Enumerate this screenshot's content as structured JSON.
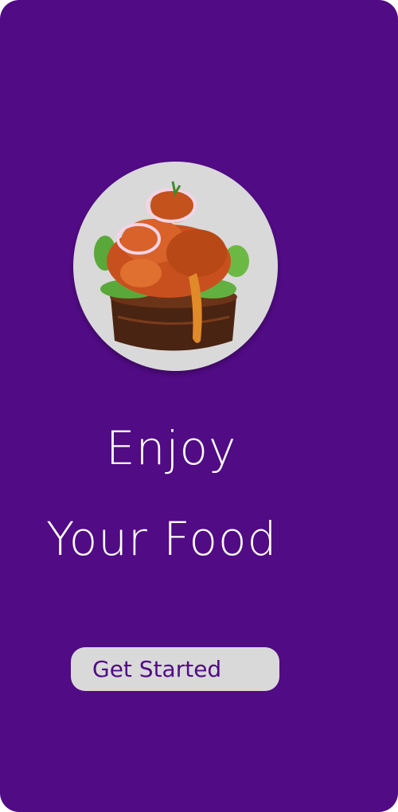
{
  "colors": {
    "background": "#510b84",
    "circle": "#d9d9d9",
    "button_background": "#d9d9d9",
    "button_text": "#510b84",
    "headline_text": "#ffffff"
  },
  "hero": {
    "image_icon": "food-bowl-image"
  },
  "headline": {
    "line1": "Enjoy",
    "line2": "Your Food"
  },
  "cta": {
    "label": "Get Started"
  }
}
